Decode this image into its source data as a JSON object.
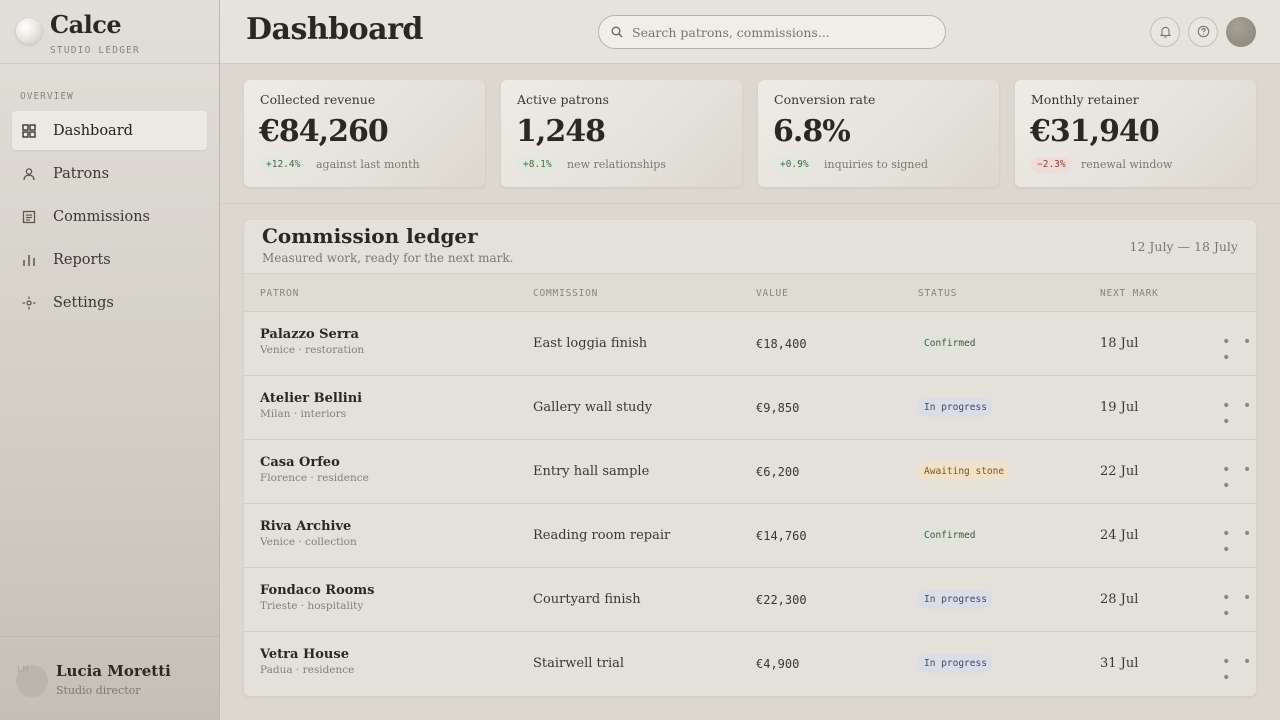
{
  "brand": {
    "name": "Calce",
    "subtitle": "STUDIO LEDGER"
  },
  "sidebar": {
    "section_heading": "OVERVIEW",
    "items": [
      {
        "label": "Dashboard",
        "icon": "grid-icon",
        "active": true
      },
      {
        "label": "Patrons",
        "icon": "person-icon"
      },
      {
        "label": "Commissions",
        "icon": "document-icon"
      },
      {
        "label": "Reports",
        "icon": "bar-chart-icon"
      },
      {
        "label": "Settings",
        "icon": "settings-icon"
      }
    ],
    "user": {
      "initials": "LM",
      "name": "Lucia Moretti",
      "role": "Studio director"
    }
  },
  "header": {
    "title": "Dashboard",
    "search_placeholder": "Search patrons, commissions...",
    "icons": [
      "bell-icon",
      "help-icon",
      "avatar"
    ]
  },
  "stats": [
    {
      "label": "Collected revenue",
      "value": "€84,260",
      "delta": "+12.4%",
      "trend": "up",
      "note": "against last month"
    },
    {
      "label": "Active patrons",
      "value": "1,248",
      "delta": "+8.1%",
      "trend": "up",
      "note": "new relationships"
    },
    {
      "label": "Conversion rate",
      "value": "6.8%",
      "delta": "+0.9%",
      "trend": "up",
      "note": "inquiries to signed"
    },
    {
      "label": "Monthly retainer",
      "value": "€31,940",
      "delta": "−2.3%",
      "trend": "down",
      "note": "renewal window"
    }
  ],
  "ledger": {
    "title": "Commission ledger",
    "subtitle": "Measured work, ready for the next mark.",
    "date_range": "12 July — 18 July",
    "columns": [
      "PATRON",
      "COMMISSION",
      "VALUE",
      "STATUS",
      "NEXT MARK"
    ],
    "rows": [
      {
        "patron": "Palazzo Serra",
        "meta": "Venice · restoration",
        "commission": "East loggia finish",
        "value": "€18,400",
        "status": "Confirmed",
        "next": "18 Jul"
      },
      {
        "patron": "Atelier Bellini",
        "meta": "Milan · interiors",
        "commission": "Gallery wall study",
        "value": "€9,850",
        "status": "In progress",
        "next": "19 Jul"
      },
      {
        "patron": "Casa Orfeo",
        "meta": "Florence · residence",
        "commission": "Entry hall sample",
        "value": "€6,200",
        "status": "Awaiting stone",
        "next": "22 Jul"
      },
      {
        "patron": "Riva Archive",
        "meta": "Venice · collection",
        "commission": "Reading room repair",
        "value": "€14,760",
        "status": "Confirmed",
        "next": "24 Jul"
      },
      {
        "patron": "Fondaco Rooms",
        "meta": "Trieste · hospitality",
        "commission": "Courtyard finish",
        "value": "€22,300",
        "status": "In progress",
        "next": "28 Jul"
      },
      {
        "patron": "Vetra House",
        "meta": "Padua · residence",
        "commission": "Stairwell trial",
        "value": "€4,900",
        "status": "In progress",
        "next": "31 Jul"
      }
    ],
    "row_action": "• • •"
  }
}
